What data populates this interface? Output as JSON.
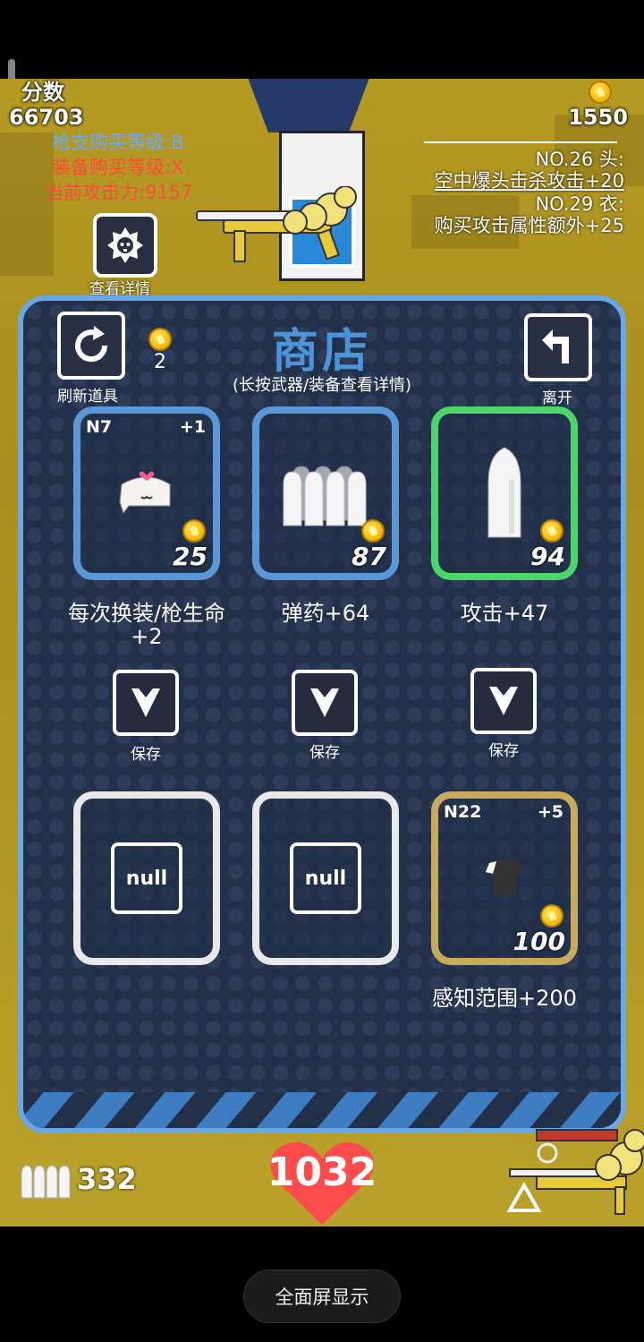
{
  "hud": {
    "score_label": "分数",
    "score_value": "66703",
    "gun_purchase_level": "枪支购买等级:B",
    "equipment_purchase_level": "装备购买等级:X",
    "current_attack": "当前攻击力:9157",
    "coins": "1550",
    "bonus_lines": [
      "NO.26 头:",
      "空中爆头击杀攻击+20",
      "NO.29 衣:",
      "购买攻击属性额外+25"
    ],
    "detail_label": "查看详情"
  },
  "shop": {
    "title": "商店",
    "subtitle": "(长按武器/装备查看详情)",
    "refresh_label": "刷新道具",
    "refresh_cost": "2",
    "leave_label": "离开",
    "items": [
      {
        "tier": "N7",
        "plus": "+1",
        "price": "25",
        "desc": "每次换装/枪生命+2"
      },
      {
        "tier": "",
        "plus": "",
        "price": "87",
        "desc": "弹药+64"
      },
      {
        "tier": "",
        "plus": "",
        "price": "94",
        "desc": "攻击+47"
      }
    ],
    "save_label": "保存",
    "saved": [
      {
        "label": "null"
      },
      {
        "label": "null"
      },
      {
        "tier": "N22",
        "plus": "+5",
        "price": "100",
        "desc": "感知范围+200"
      }
    ]
  },
  "status": {
    "ammo": "332",
    "hp": "1032"
  },
  "system": {
    "fullscreen": "全面屏显示"
  },
  "colors": {
    "shop_border": "#6aa7e6",
    "selected_border": "#4cd66a",
    "gold_border": "#c9aa5c",
    "gun_level_text": "#6aa9ff",
    "equip_level_text": "#ff4a3a"
  }
}
